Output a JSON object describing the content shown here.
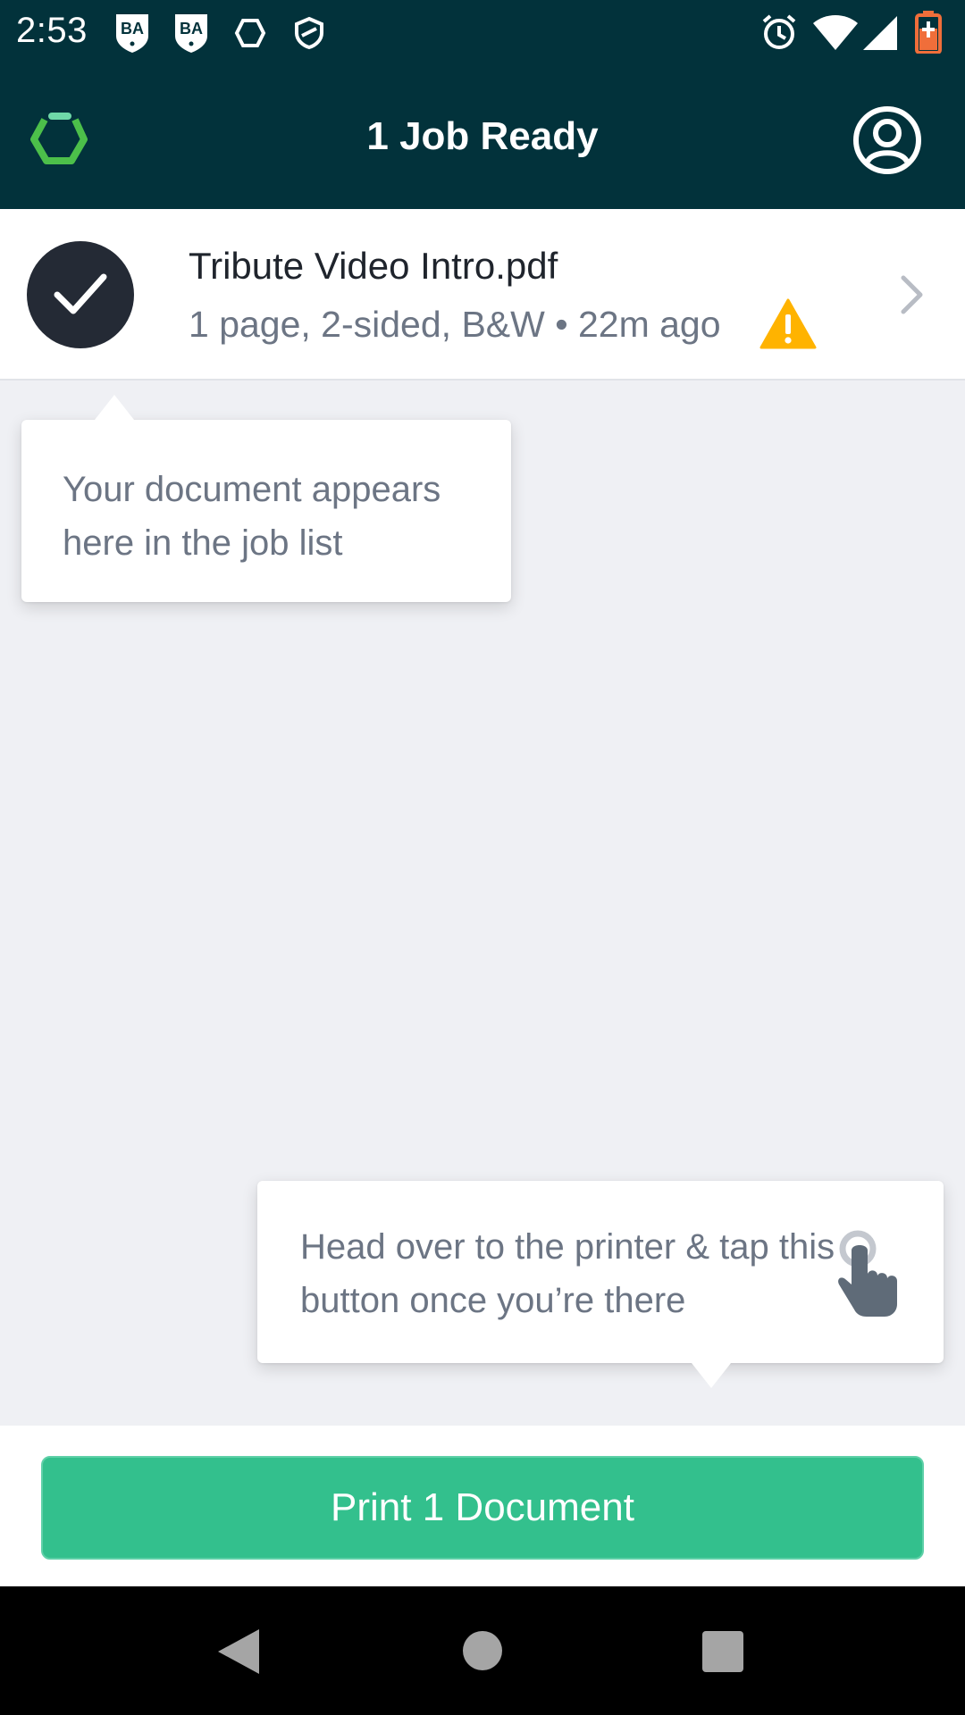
{
  "status_bar": {
    "time": "2:53",
    "left_icons": [
      "ba-shield-icon",
      "ba-shield-icon",
      "hexagon-icon",
      "vpn-icon"
    ],
    "right_icons": [
      "alarm-icon",
      "wifi-icon",
      "signal-icon",
      "battery-charging-icon"
    ],
    "badge_text": "BA"
  },
  "app_bar": {
    "title": "1 Job Ready",
    "logo_icon": "app-logo-hexagon-icon",
    "account_icon": "account-circle-icon"
  },
  "job": {
    "name": "Tribute Video Intro.pdf",
    "meta": "1 page, 2-sided, B&W • 22m ago",
    "status_icon": "check-icon",
    "warning_icon": "warning-icon",
    "chevron_icon": "chevron-right-icon"
  },
  "tooltips": {
    "job_list": "Your document appears here in the job list",
    "printer": "Head over to the printer & tap this button once you’re there",
    "tap_icon": "tap-finger-icon"
  },
  "actions": {
    "print_label": "Print 1 Document"
  },
  "nav": {
    "back_icon": "back-icon",
    "home_icon": "home-icon",
    "recents_icon": "recents-icon"
  },
  "colors": {
    "header": "#02323b",
    "accent": "#33c08d",
    "warning": "#ffb300",
    "logo_green": "#4cbf4a"
  }
}
